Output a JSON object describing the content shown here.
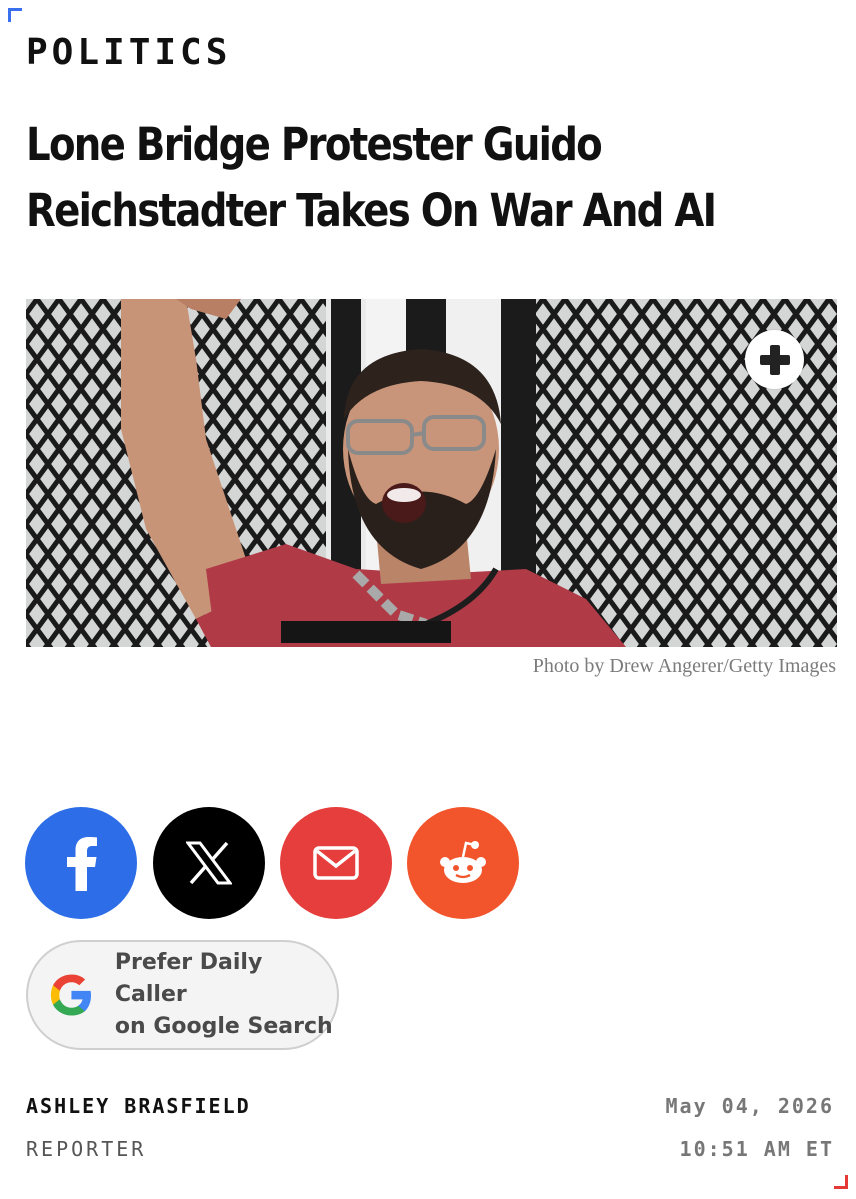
{
  "article": {
    "category": "POLITICS",
    "headline_line1": "Lone Bridge Protester Guido",
    "headline_line2": "Reichstadter Takes On War And AI",
    "photo_caption": "Photo by Drew Angerer/Getty Images",
    "image_alt": "Protester raising fist in front of a security fence"
  },
  "share": {
    "buttons": [
      {
        "name": "facebook",
        "icon": "facebook-icon",
        "color": "#2d6ee8"
      },
      {
        "name": "x",
        "icon": "x-icon",
        "color": "#000000"
      },
      {
        "name": "email",
        "icon": "mail-icon",
        "color": "#e53e3c"
      },
      {
        "name": "reddit",
        "icon": "reddit-icon",
        "color": "#f2552b"
      }
    ],
    "google_line1": "Prefer Daily Caller",
    "google_line2": "on Google Search"
  },
  "byline": {
    "author": "ASHLEY BRASFIELD",
    "role": "REPORTER",
    "date": "May 04, 2026",
    "time": "10:51 AM ET"
  },
  "colors": {
    "accent_blue": "#3a6ff0",
    "accent_red": "#e53935"
  }
}
